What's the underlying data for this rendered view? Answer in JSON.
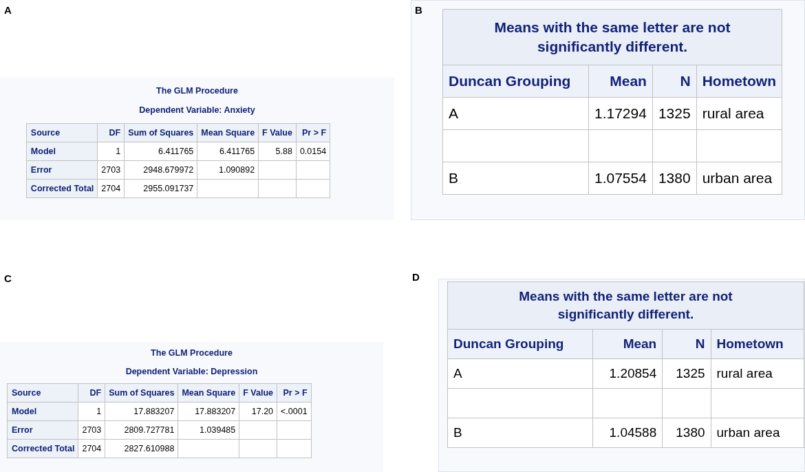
{
  "panels": [
    {
      "label": "A",
      "kind": "anova",
      "title": "The GLM Procedure",
      "subtitle": "Dependent Variable: Anxiety",
      "columns": [
        "Source",
        "DF",
        "Sum of Squares",
        "Mean Square",
        "F Value",
        "Pr > F"
      ],
      "rows": [
        {
          "cells": [
            "Model",
            "1",
            "6.411765",
            "6.411765",
            "5.88",
            "0.0154"
          ]
        },
        {
          "cells": [
            "Error",
            "2703",
            "2948.679972",
            "1.090892"
          ]
        },
        {
          "cells": [
            "Corrected Total",
            "2704",
            "2955.091737"
          ]
        }
      ]
    },
    {
      "label": "B",
      "kind": "grouping",
      "caption": "Means with the same letter are not significantly different.",
      "columns": [
        "Duncan Grouping",
        "Mean",
        "N",
        "Hometown"
      ],
      "rows": [
        {
          "kind": "data",
          "cells": [
            "A",
            "1.17294",
            "1325",
            "rural area"
          ]
        },
        {
          "kind": "spacer"
        },
        {
          "kind": "data",
          "cells": [
            "B",
            "1.07554",
            "1380",
            "urban area"
          ]
        }
      ]
    },
    {
      "label": "C",
      "kind": "anova",
      "title": "The GLM Procedure",
      "subtitle": "Dependent Variable: Depression",
      "columns": [
        "Source",
        "DF",
        "Sum of Squares",
        "Mean Square",
        "F Value",
        "Pr > F"
      ],
      "rows": [
        {
          "cells": [
            "Model",
            "1",
            "17.883207",
            "17.883207",
            "17.20",
            "<.0001"
          ]
        },
        {
          "cells": [
            "Error",
            "2703",
            "2809.727781",
            "1.039485"
          ]
        },
        {
          "cells": [
            "Corrected Total",
            "2704",
            "2827.610988"
          ]
        }
      ]
    },
    {
      "label": "D",
      "kind": "grouping",
      "caption": "Means with the same letter are not significantly different.",
      "columns": [
        "Duncan Grouping",
        "Mean",
        "N",
        "Hometown"
      ],
      "rows": [
        {
          "kind": "data",
          "cells": [
            "A",
            "1.20854",
            "1325",
            "rural area"
          ]
        },
        {
          "kind": "spacer"
        },
        {
          "kind": "data",
          "cells": [
            "B",
            "1.04588",
            "1380",
            "urban area"
          ]
        }
      ]
    }
  ]
}
